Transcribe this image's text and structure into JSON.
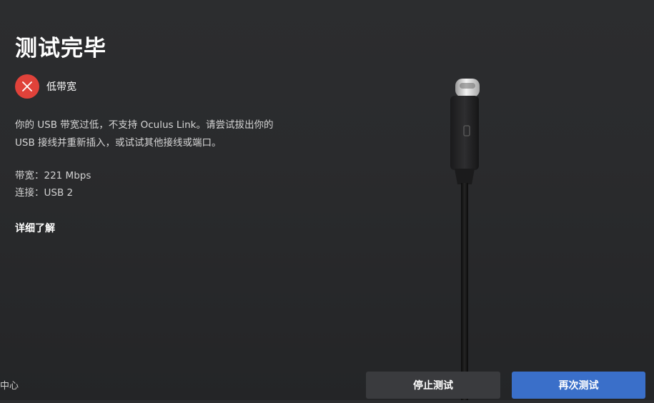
{
  "page": {
    "title": "测试完毕",
    "status": {
      "label": "低带宽",
      "icon": "close-icon",
      "color": "#e0423a"
    },
    "description": [
      "你的 USB 带宽过低，不支持 Oculus Link。请尝试拔出你的",
      "USB 接线并重新插入，或试试其他接线或端口。"
    ],
    "bandwidth": "带宽：221 Mbps",
    "connection": "连接：USB 2",
    "learn_more": "详细了解"
  },
  "footer": {
    "left_text": "中心",
    "stop_button": "停止测试",
    "retest_button": "再次测试",
    "accent": "#3a6fc9"
  },
  "illustration": {
    "icon": "usb-c-cable-icon"
  }
}
